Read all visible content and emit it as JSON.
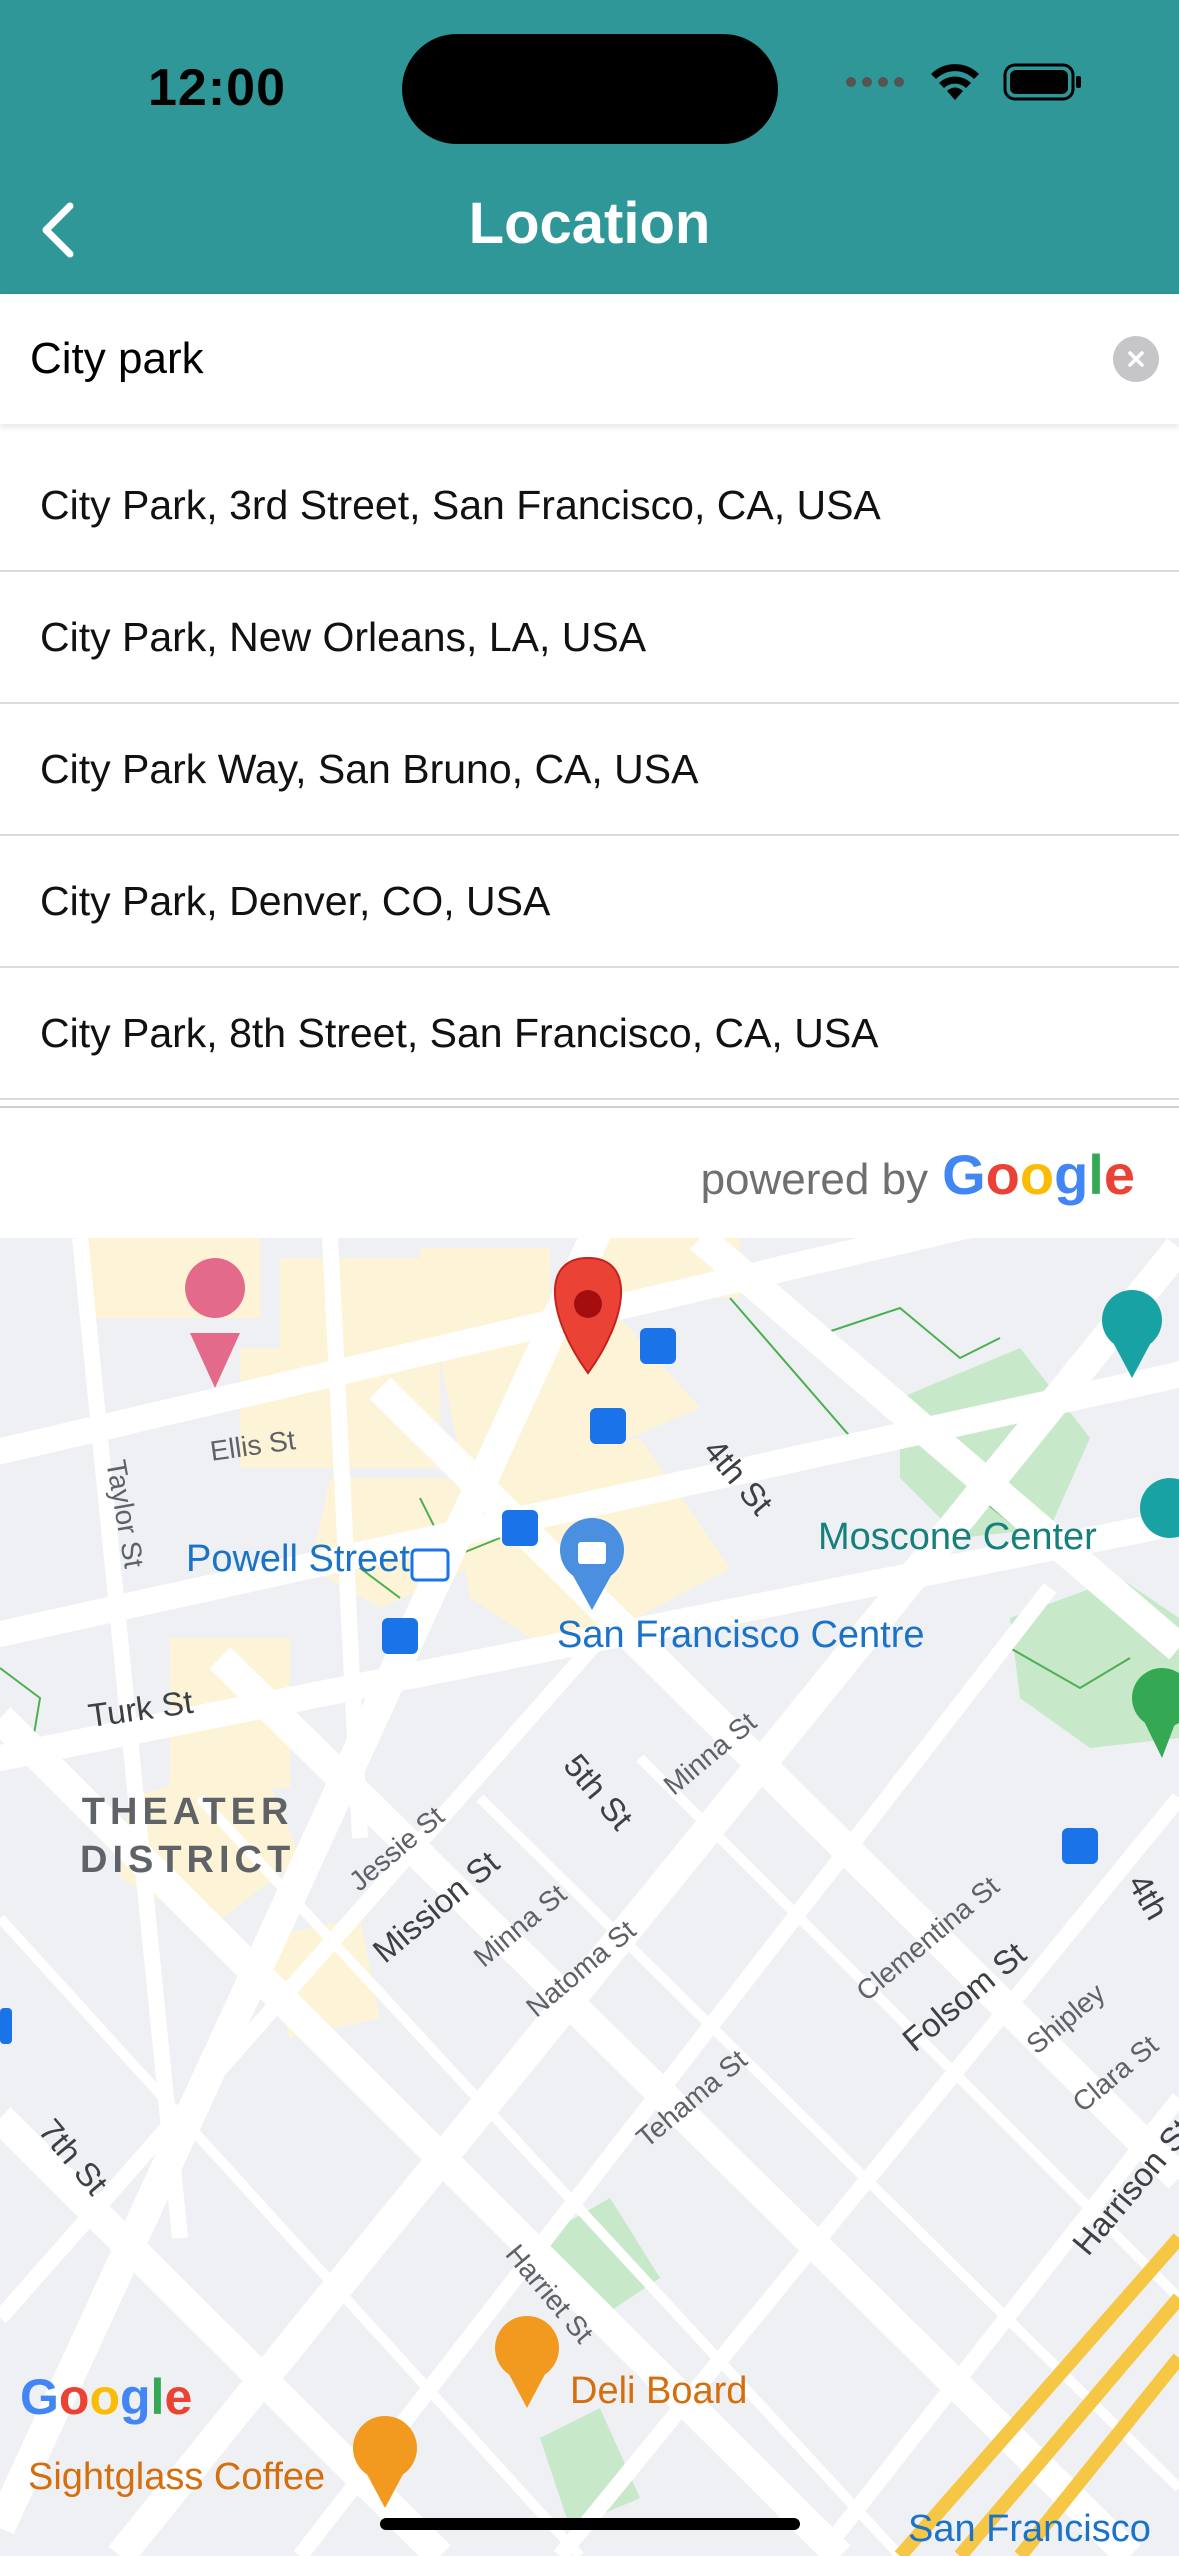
{
  "status": {
    "time": "12:00"
  },
  "header": {
    "title": "Location"
  },
  "search": {
    "value": "City park",
    "placeholder": ""
  },
  "suggestions": [
    "City Park, 3rd Street, San Francisco, CA, USA",
    "City Park, New Orleans, LA, USA",
    "City Park Way, San Bruno, CA, USA",
    "City Park, Denver, CO, USA",
    "City Park, 8th Street, San Francisco, CA, USA"
  ],
  "attribution": {
    "powered_by": "powered by",
    "google": [
      "G",
      "o",
      "o",
      "g",
      "l",
      "e"
    ]
  },
  "map": {
    "streets": {
      "ellis": "Ellis St",
      "taylor": "Taylor St",
      "turk": "Turk St",
      "fourth": "4th St",
      "fifth": "5th St",
      "seventh": "7th St",
      "mission": "Mission St",
      "jessie": "Jessie St",
      "minna1": "Minna St",
      "minna2": "Minna St",
      "minna3": "Minna St",
      "natoma": "Natoma St",
      "tehama": "Tehama St",
      "clementina": "Clementina St",
      "folsom": "Folsom St",
      "shipley": "Shipley",
      "clara": "Clara St",
      "harrison": "Harrison St",
      "harriet": "Harriet St",
      "fourth_edge": "4th"
    },
    "places": {
      "powell": "Powell Street",
      "sf_centre": "San Francisco Centre",
      "moscone": "Moscone Center",
      "district_line1": "THEATER",
      "district_line2": "DISTRICT",
      "deli": "Deli Board",
      "sightglass": "Sightglass Coffee",
      "sf_bottom": "San Francisco"
    },
    "logo": [
      "G",
      "o",
      "o",
      "g",
      "l",
      "e"
    ]
  },
  "colors": {
    "header": "#2f9797",
    "pin": "#ea4335",
    "google_blue": "#4285F4",
    "google_red": "#EA4335",
    "google_yellow": "#FBBC05",
    "google_green": "#34A853"
  }
}
